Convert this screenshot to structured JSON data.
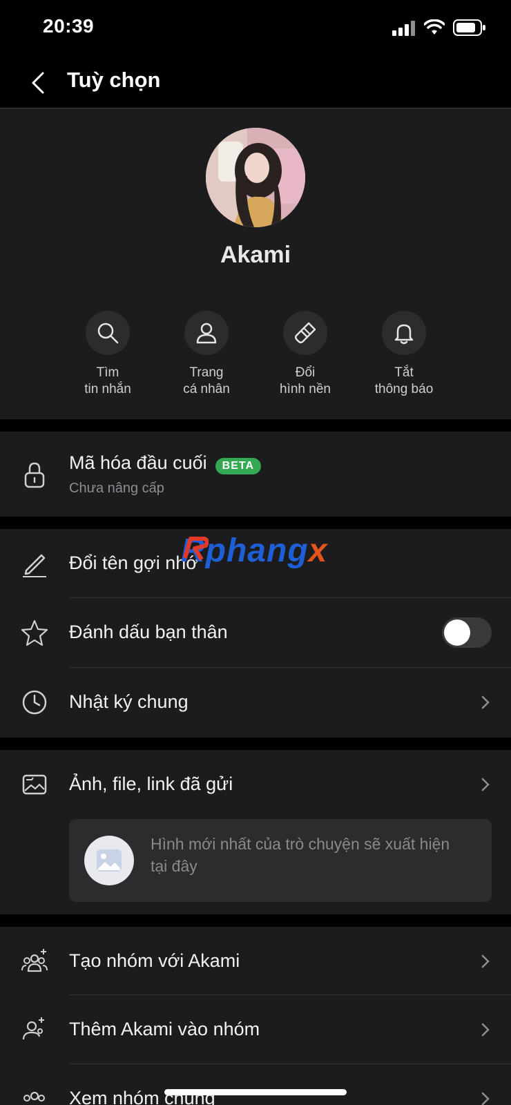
{
  "status_bar": {
    "time": "20:39"
  },
  "header": {
    "title": "Tuỳ chọn"
  },
  "profile": {
    "name": "Akami"
  },
  "actions": [
    {
      "label": "Tìm\ntin nhắn",
      "icon": "search-icon"
    },
    {
      "label": "Trang\ncá nhân",
      "icon": "person-icon"
    },
    {
      "label": "Đổi\nhình nền",
      "icon": "paint-brush-icon"
    },
    {
      "label": "Tắt\nthông báo",
      "icon": "bell-icon"
    }
  ],
  "encryption": {
    "title": "Mã hóa đầu cuối",
    "badge": "BETA",
    "subtitle": "Chưa nâng cấp"
  },
  "rows": {
    "rename": "Đổi tên gợi nhớ",
    "best_friend": "Đánh dấu bạn thân",
    "best_friend_on": false,
    "shared_diary": "Nhật ký chung",
    "media": "Ảnh, file, link đã gửi",
    "media_placeholder": "Hình mới nhất của trò chuyện sẽ xuất hiện tại đây",
    "create_group": "Tạo nhóm với Akami",
    "add_to_group": "Thêm Akami vào nhóm",
    "common_groups": "Xem nhóm chung"
  },
  "watermark": {
    "part1": "Rphang",
    "part2": "x"
  },
  "colors": {
    "panel": "#1c1c1e",
    "background": "#000000",
    "badge": "#34a853"
  }
}
